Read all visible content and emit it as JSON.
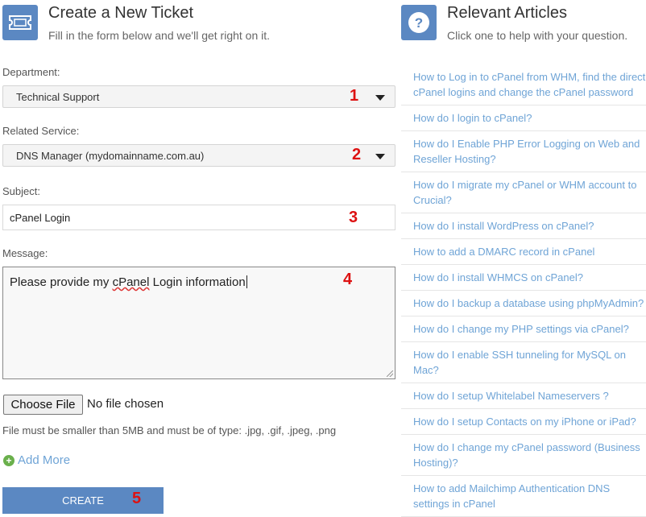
{
  "ticket_header": {
    "icon": "ticket-icon",
    "title": "Create a New Ticket",
    "subtitle": "Fill in the form below and we'll get right on it."
  },
  "articles_header": {
    "icon": "question-icon",
    "title": "Relevant Articles",
    "subtitle": "Click one to help with your question."
  },
  "form": {
    "department": {
      "label": "Department:",
      "value": "Technical Support"
    },
    "service": {
      "label": "Related Service:",
      "value": "DNS Manager (mydomainname.com.au)"
    },
    "subject": {
      "label": "Subject:",
      "value": "cPanel Login"
    },
    "message": {
      "label": "Message:",
      "before": "Please provide my ",
      "misspelled": "cPanel",
      "after": " Login information"
    },
    "file": {
      "button": "Choose File",
      "status": "No file chosen",
      "help": "File must be smaller than 5MB and must be of type: .jpg, .gif, .jpeg, .png"
    },
    "add_more": "Add More",
    "create": "CREATE"
  },
  "annotations": [
    "1",
    "2",
    "3",
    "4",
    "5"
  ],
  "articles": [
    "How to Log in to cPanel from WHM, find the direct cPanel logins and change the cPanel password",
    "How do I login to cPanel?",
    "How do I Enable PHP Error Logging on Web and Reseller Hosting?",
    "How do I migrate my cPanel or WHM account to Crucial?",
    "How do I install WordPress on cPanel?",
    "How to add a DMARC record in cPanel",
    "How do I install WHMCS on cPanel?",
    "How do I backup a database using phpMyAdmin?",
    "How do I change my PHP settings via cPanel?",
    "How do I enable SSH tunneling for MySQL on Mac?",
    "How do I setup Whitelabel Nameservers ?",
    "How do I setup Contacts on my iPhone or iPad?",
    "How do I change my cPanel password (Business Hosting)?",
    "How to add Mailchimp Authentication DNS settings in cPanel"
  ],
  "colors": {
    "accent": "#5b88c2",
    "link": "#6fa4d6",
    "annotation": "#dd1111",
    "add": "#6ab04c"
  }
}
